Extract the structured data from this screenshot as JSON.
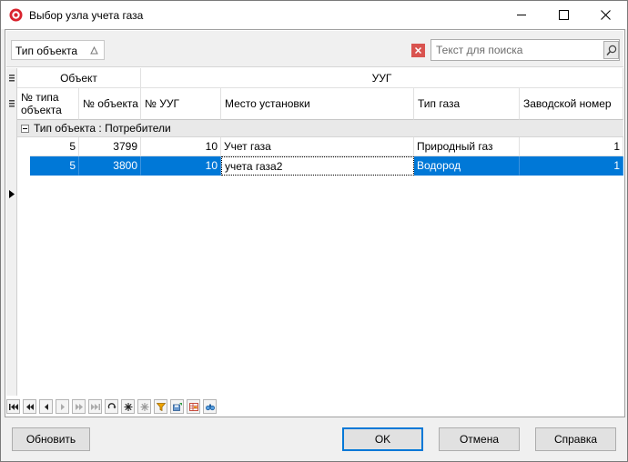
{
  "window": {
    "title": "Выбор узла учета газа",
    "icon": "red-app-icon",
    "controls": {
      "minimize": "minimize-icon",
      "maximize": "maximize-icon",
      "close": "close-icon"
    }
  },
  "group_panel": {
    "group_field": "Тип объекта",
    "sort": "ascending"
  },
  "search": {
    "placeholder": "Текст для поиска",
    "value": ""
  },
  "grid": {
    "bands": [
      {
        "label": "Объект"
      },
      {
        "label": "УУГ"
      }
    ],
    "columns": [
      {
        "label": "№ типа\nобъекта"
      },
      {
        "label": "№ объекта"
      },
      {
        "label": "№ УУГ"
      },
      {
        "label": "Место установки"
      },
      {
        "label": "Тип газа"
      },
      {
        "label": "Заводской номер"
      }
    ],
    "group_label": "Тип объекта : Потребители",
    "rows": [
      [
        "5",
        "3799",
        "10",
        "Учет газа",
        "Природный газ",
        "1"
      ],
      [
        "5",
        "3800",
        "10",
        "учета газа2",
        "Водород",
        "1"
      ]
    ],
    "selected_row": 1,
    "focused_column": 3
  },
  "navigator": {
    "buttons": [
      "first-icon",
      "prev-page-icon",
      "prev-icon",
      "next-icon",
      "next-page-icon",
      "last-icon",
      "refresh-icon",
      "insert-icon",
      "delete-icon",
      "filter-icon",
      "save-icon",
      "grid-icon",
      "find-icon"
    ]
  },
  "buttons": {
    "refresh": "Обновить",
    "ok": "OK",
    "cancel": "Отмена",
    "help": "Справка"
  },
  "colors": {
    "selection": "#0078d7",
    "clear_search": "#d9534f",
    "default_button_border": "#0078d7"
  }
}
